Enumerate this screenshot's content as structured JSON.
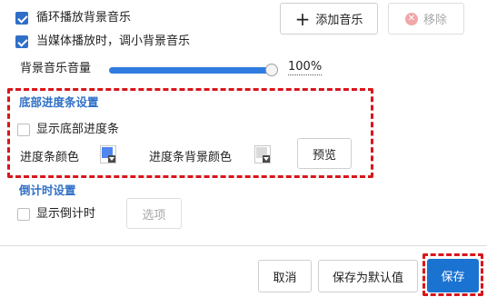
{
  "music": {
    "loop_label": "循环播放背景音乐",
    "duck_label": "当媒体播放时，调小背景音乐",
    "add_button": "添加音乐",
    "remove_button": "移除",
    "volume_label": "背景音乐音量",
    "volume_value": "100%",
    "volume_fraction": 1.0
  },
  "progress_bar": {
    "section_title": "底部进度条设置",
    "show_label": "显示底部进度条",
    "bar_color_label": "进度条颜色",
    "bar_color": "#4f86f0",
    "bg_color_label": "进度条背景颜色",
    "bg_color": "#d9d9d9",
    "preview_button": "预览"
  },
  "countdown": {
    "section_title": "倒计时设置",
    "show_label": "显示倒计时",
    "options_button": "选项"
  },
  "footer": {
    "cancel_button": "取消",
    "save_default_button": "保存为默认值",
    "save_button": "保存"
  },
  "colors": {
    "accent": "#2f6fc8",
    "save_bg": "#1a73d1",
    "highlight": "#d8161b"
  }
}
